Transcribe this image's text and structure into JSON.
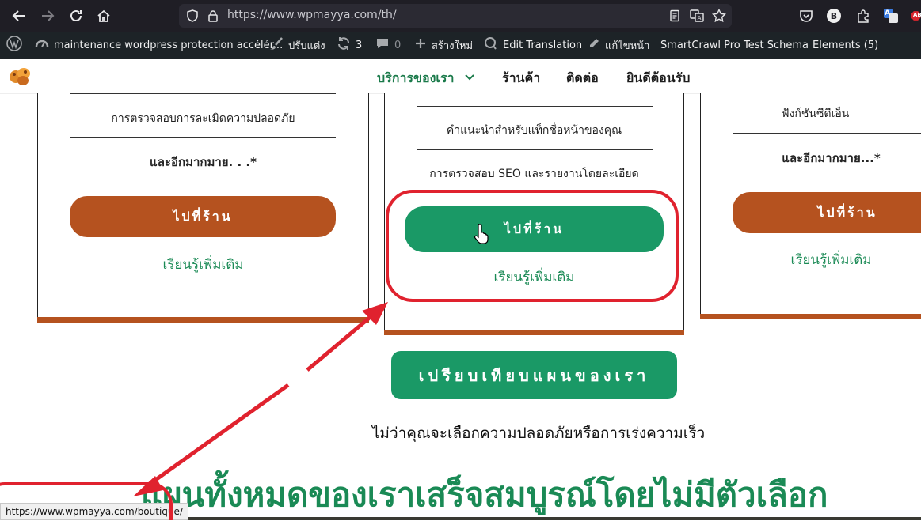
{
  "browser": {
    "url": "https://www.wpmayya.com/th/",
    "status_url": "https://www.wpmayya.com/boutique/",
    "translate_badge": "A",
    "profile_initial": "B",
    "abp_badge": "ABP"
  },
  "admin_bar": {
    "site_name": "maintenance wordpress protection accélér...",
    "customize": "ปรับแต่ง",
    "updates_count": "3",
    "comments_count": "0",
    "new": "สร้างใหม่",
    "edit_translation": "Edit Translation",
    "edit_page": "แก้ไขหน้า",
    "smartcrawl": "SmartCrawl Pro",
    "test_schema": "Test Schema",
    "elements": "Elements (5)"
  },
  "site_menu": {
    "services": "บริการของเรา",
    "shop": "ร้านค้า",
    "contact": "ติดต่อ",
    "welcome": "ยินดีต้อนรับ"
  },
  "cards": {
    "left": {
      "feature_1": "การตรวจสอบการละเมิดความปลอดภัย",
      "more": "และอีกมากมาย. . .*",
      "shop_button": "ไปที่ร้าน",
      "learn_more": "เรียนรู้เพิ่มเติม"
    },
    "middle": {
      "feature_1": "คำแนะนำสำหรับแท็กชื่อหน้าของคุณ",
      "feature_2": "การตรวจสอบ SEO และรายงานโดยละเอียด",
      "shop_button": "ไปที่ร้าน",
      "learn_more": "เรียนรู้เพิ่มเติม"
    },
    "right": {
      "feature_1": "ฟังก์ชันซีดีเอ็น",
      "more": "และอีกมากมาย...*",
      "shop_button": "ไปที่ร้าน",
      "learn_more": "เรียนรู้เพิ่มเติม"
    }
  },
  "compare_button": "เปรียบเทียบแผนของเรา",
  "subtitle": "ไม่ว่าคุณจะเลือกความปลอดภัยหรือการเร่งความเร็ว",
  "heading": "แผนทั้งหมดของเราเสร็จสมบูรณ์โดยไม่มีตัวเลือก",
  "colors": {
    "brand_green": "#1a9966",
    "brand_brown": "#b5521f",
    "annotation_red": "#e0222e",
    "admin_bar": "#1d2327",
    "browser_toolbar": "#1f1e25"
  },
  "icons": [
    "back-icon",
    "forward-icon",
    "reload-icon",
    "home-icon",
    "shield-icon",
    "lock-icon",
    "reader-icon",
    "translate-icon",
    "bookmark-star-icon",
    "pocket-icon",
    "account-icon",
    "extensions-icon",
    "translate-extension-icon",
    "adblock-icon",
    "wordpress-icon",
    "dashboard-icon",
    "brush-icon",
    "updates-icon",
    "comments-icon",
    "plus-icon",
    "translate-edit-icon",
    "pencil-icon",
    "chevron-down-icon",
    "pointer-hand-icon"
  ]
}
